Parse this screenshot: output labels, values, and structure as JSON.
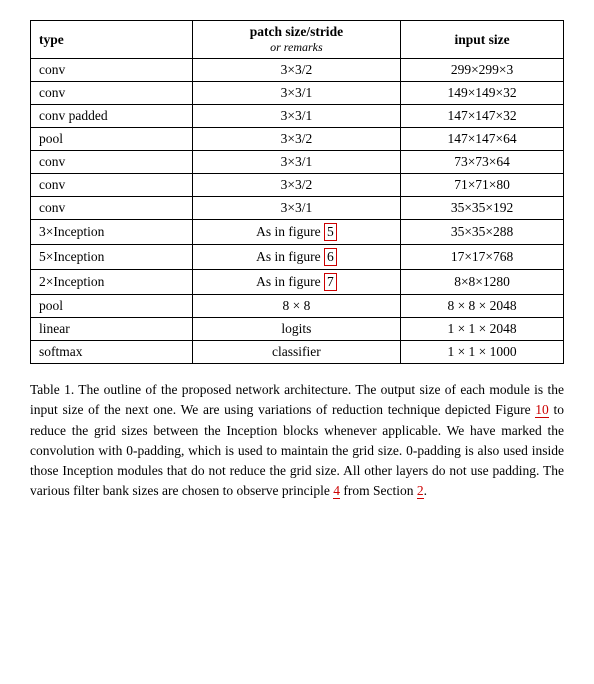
{
  "table": {
    "headers": {
      "col1": "type",
      "col2_line1": "patch size/stride",
      "col2_line2": "or remarks",
      "col3": "input size"
    },
    "rows": [
      {
        "type": "conv",
        "patch": "3×3/2",
        "input": "299×299×3"
      },
      {
        "type": "conv",
        "patch": "3×3/1",
        "input": "149×149×32"
      },
      {
        "type": "conv padded",
        "patch": "3×3/1",
        "input": "147×147×32"
      },
      {
        "type": "pool",
        "patch": "3×3/2",
        "input": "147×147×64"
      },
      {
        "type": "conv",
        "patch": "3×3/1",
        "input": "73×73×64"
      },
      {
        "type": "conv",
        "patch": "3×3/2",
        "input": "71×71×80"
      },
      {
        "type": "conv",
        "patch": "3×3/1",
        "input": "35×35×192"
      },
      {
        "type": "3×Inception",
        "patch": "As in figure 5",
        "input": "35×35×288",
        "highlight": "5"
      },
      {
        "type": "5×Inception",
        "patch": "As in figure 6",
        "input": "17×17×768",
        "highlight": "6"
      },
      {
        "type": "2×Inception",
        "patch": "As in figure 7",
        "input": "8×8×1280",
        "highlight": "7"
      },
      {
        "type": "pool",
        "patch": "8 × 8",
        "input": "8 × 8 × 2048"
      },
      {
        "type": "linear",
        "patch": "logits",
        "input": "1 × 1 × 2048"
      },
      {
        "type": "softmax",
        "patch": "classifier",
        "input": "1 × 1 × 1000"
      }
    ]
  },
  "caption": {
    "prefix": "Table 1. The outline of the proposed network architecture.  The output size of each module is the input size of the next one.  We are using variations of reduction technique depicted Figure ",
    "ref10": "10",
    "middle": " to reduce the grid sizes between the Inception blocks whenever applicable.  We have marked the convolution with 0-padding, which is used to maintain the grid size.  0-padding is also used inside those Inception modules that do not reduce the grid size.  All other layers do not use padding.  The various filter bank sizes are chosen to observe principle ",
    "ref4": "4",
    "middle2": " from Section ",
    "ref2": "2",
    "suffix": "."
  }
}
